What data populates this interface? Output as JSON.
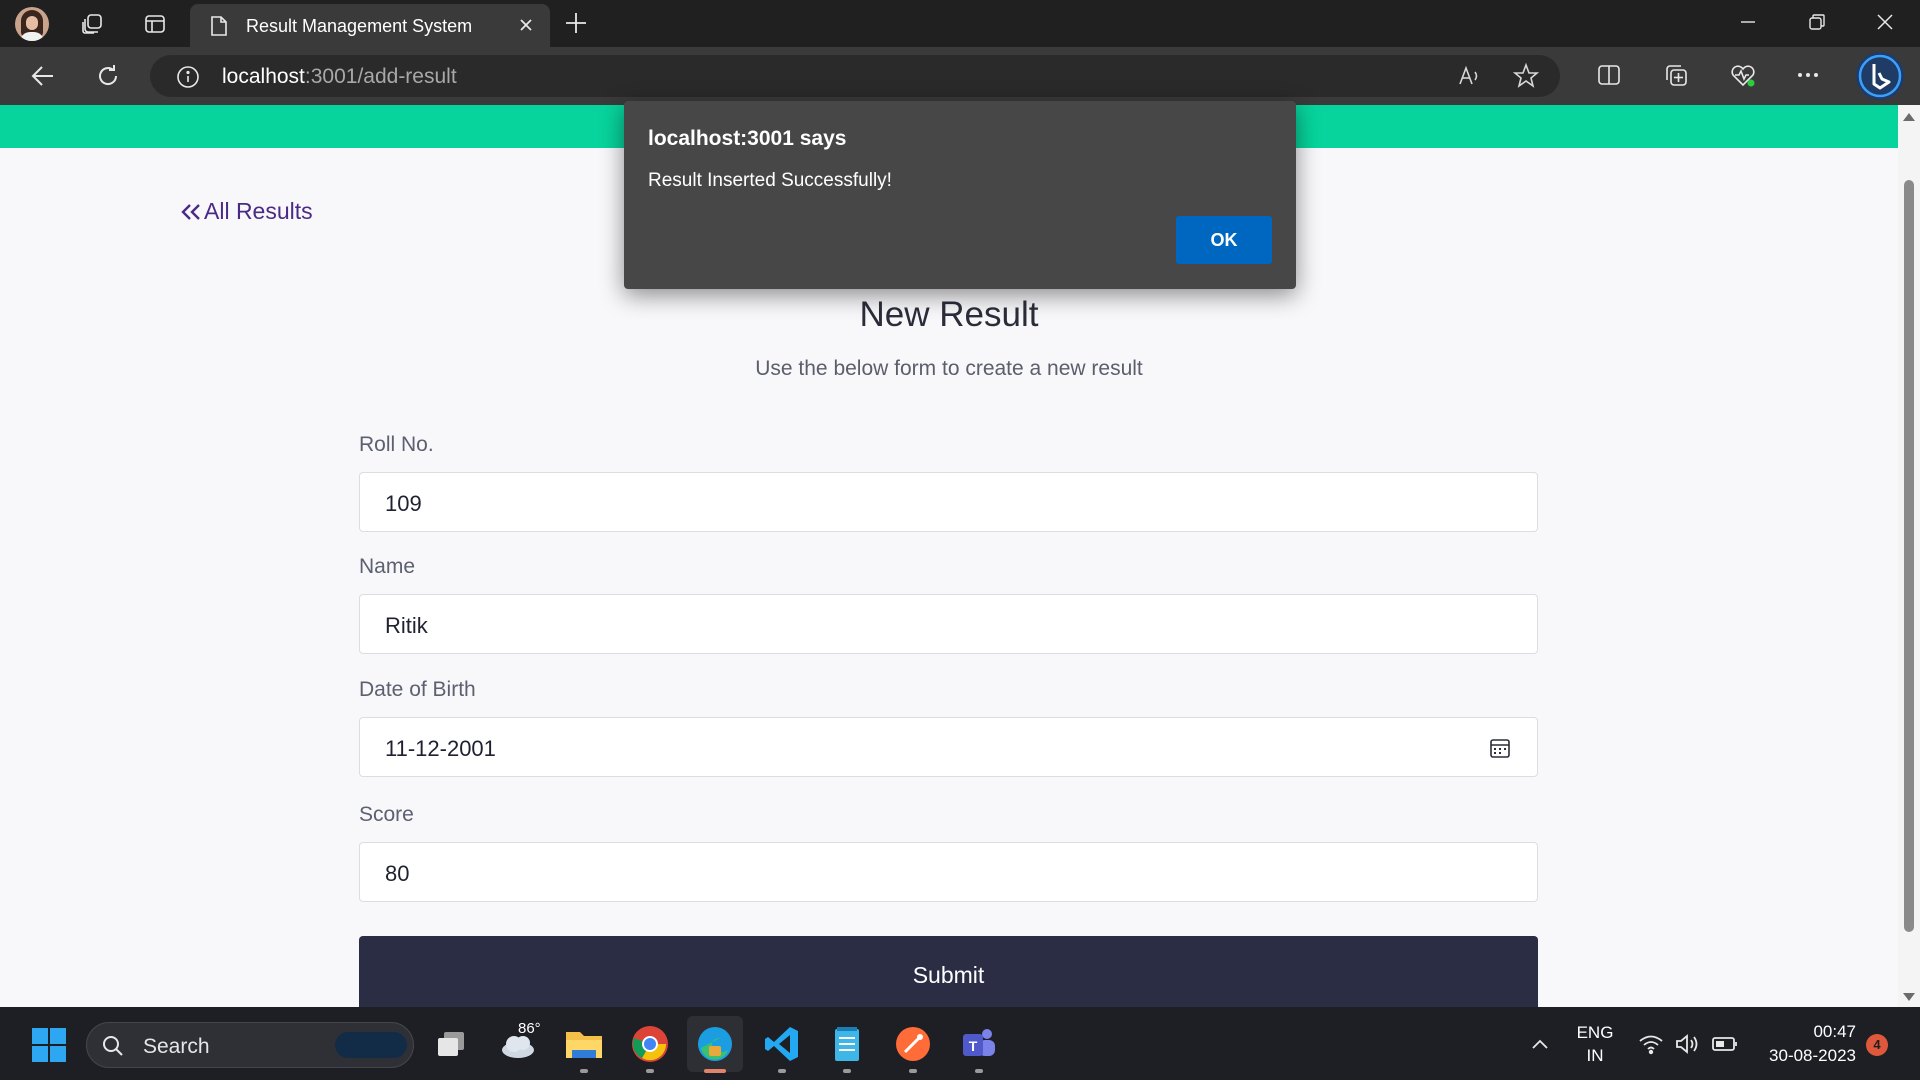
{
  "browser": {
    "tab_title": "Result Management System",
    "url_host": "localhost",
    "url_rest": ":3001/add-result"
  },
  "page": {
    "back_link": "All Results",
    "title": "New Result",
    "subtitle": "Use the below form to create a new result",
    "accent_color": "#07d49c",
    "fields": [
      {
        "label": "Roll No.",
        "value": "109"
      },
      {
        "label": "Name",
        "value": "Ritik"
      },
      {
        "label": "Date of Birth",
        "value": "11-12-2001"
      },
      {
        "label": "Score",
        "value": "80"
      }
    ],
    "submit_label": "Submit"
  },
  "dialog": {
    "title": "localhost:3001 says",
    "message": "Result Inserted Successfully!",
    "ok_label": "OK"
  },
  "taskbar": {
    "search_label": "Search",
    "weather_temp": "86°",
    "lang_top": "ENG",
    "lang_bottom": "IN",
    "time": "00:47",
    "date": "30-08-2023",
    "notification_count": "4"
  }
}
